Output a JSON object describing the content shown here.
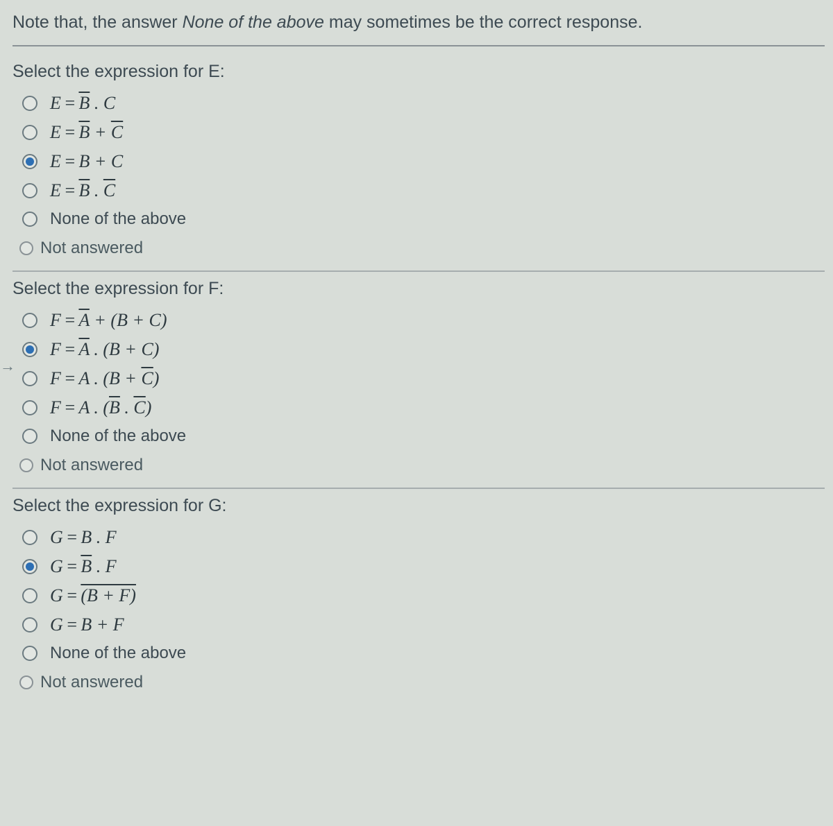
{
  "note_prefix": "Note that, the answer ",
  "note_italic": "None of the above",
  "note_suffix": " may sometimes be the correct response.",
  "not_answered_label": "Not answered",
  "none_label": "None of the above",
  "questions": [
    {
      "prompt": "Select the expression for E:",
      "selected_index": 2,
      "options": [
        {
          "lhs": "E",
          "rhs_html": "<span class='overline'>B</span> . C"
        },
        {
          "lhs": "E",
          "rhs_html": "<span class='overline'>B</span> + <span class='overline'>C</span>"
        },
        {
          "lhs": "E",
          "rhs_html": "B + C"
        },
        {
          "lhs": "E",
          "rhs_html": "<span class='overline'>B</span> . <span class='overline'>C</span>"
        },
        {
          "none": true
        }
      ]
    },
    {
      "prompt": "Select the expression for F:",
      "selected_index": 1,
      "options": [
        {
          "lhs": "F",
          "rhs_html": "<span class='overline'>A</span> + (B + C)"
        },
        {
          "lhs": "F",
          "rhs_html": "<span class='overline'>A</span> . (B + C)"
        },
        {
          "lhs": "F",
          "rhs_html": "A . (B + <span class='overline'>C</span>)"
        },
        {
          "lhs": "F",
          "rhs_html": "A . (<span class='overline'>B</span> . <span class='overline'>C</span>)"
        },
        {
          "none": true
        }
      ]
    },
    {
      "prompt": "Select the expression for G:",
      "selected_index": 1,
      "options": [
        {
          "lhs": "G",
          "rhs_html": "B . F"
        },
        {
          "lhs": "G",
          "rhs_html": "<span class='overline'>B</span> . F"
        },
        {
          "lhs": "G",
          "rhs_html": "<span class='overline'>(B + F)</span>"
        },
        {
          "lhs": "G",
          "rhs_html": "B + F"
        },
        {
          "none": true
        }
      ]
    }
  ]
}
